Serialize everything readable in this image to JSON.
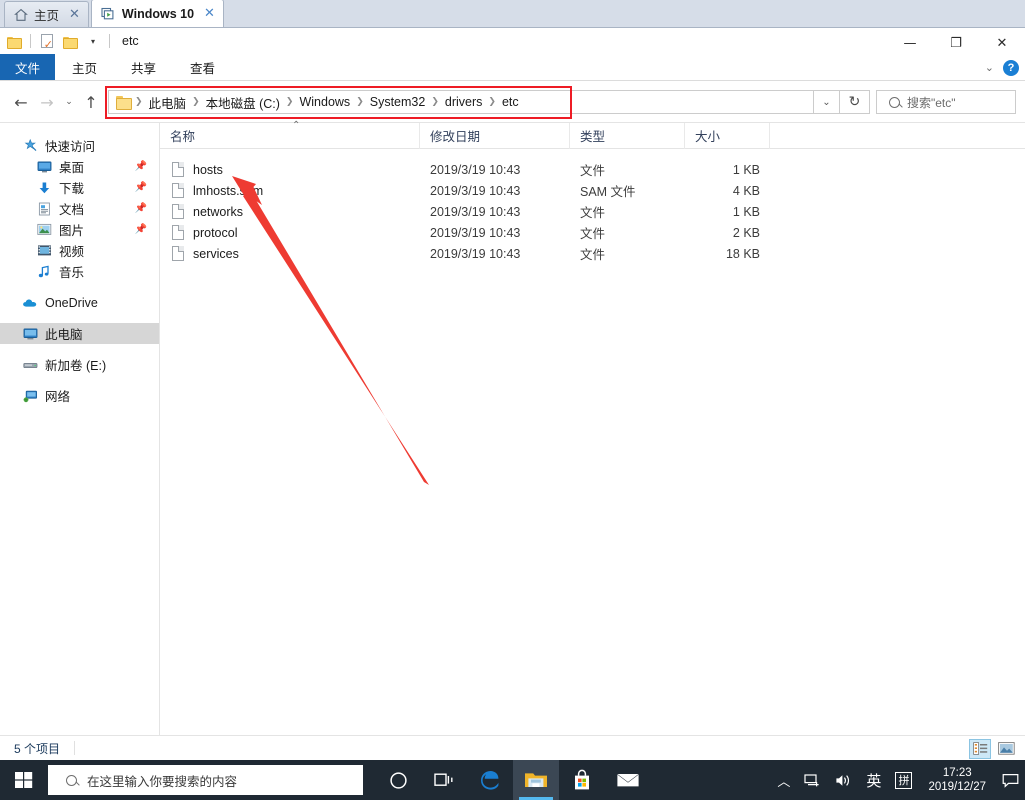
{
  "tabs": [
    {
      "label": "主页",
      "icon": "home-icon",
      "active": false,
      "close": "✕"
    },
    {
      "label": "Windows 10",
      "icon": "virtual-machine-icon",
      "active": true,
      "close": "✕"
    }
  ],
  "window": {
    "title": "etc",
    "minimize": "—",
    "maximize": "❐",
    "close": "✕"
  },
  "quick_access_toolbar": {
    "folder_icon": "folder-icon",
    "properties_icon": "properties-icon",
    "new_folder_icon": "new-folder-icon",
    "customize_caret": "▾"
  },
  "ribbon": {
    "tabs": [
      {
        "label": "文件",
        "active_style": "file"
      },
      {
        "label": "主页"
      },
      {
        "label": "共享"
      },
      {
        "label": "查看"
      }
    ],
    "collapse_caret": "⌄",
    "help": "?"
  },
  "navigation": {
    "back": "←",
    "forward": "→",
    "recent": "⌄",
    "up": "↑"
  },
  "address_bar": {
    "folder_icon": "folder-icon",
    "separator": "❯",
    "crumbs": [
      "此电脑",
      "本地磁盘 (C:)",
      "Windows",
      "System32",
      "drivers",
      "etc"
    ],
    "dropdown": "⌄",
    "refresh": "↻",
    "highlight_color": "#ee1c25"
  },
  "search": {
    "icon": "search-icon",
    "placeholder": "搜索\"etc\""
  },
  "sidebar": {
    "groups": [
      {
        "header": {
          "label": "快速访问",
          "icon": "star-pin-icon"
        },
        "items": [
          {
            "label": "桌面",
            "icon": "desktop-icon",
            "pinned": true
          },
          {
            "label": "下载",
            "icon": "download-icon",
            "pinned": true
          },
          {
            "label": "文档",
            "icon": "documents-icon",
            "pinned": true
          },
          {
            "label": "图片",
            "icon": "pictures-icon",
            "pinned": true
          },
          {
            "label": "视频",
            "icon": "videos-icon",
            "pinned": false
          },
          {
            "label": "音乐",
            "icon": "music-icon",
            "pinned": false
          }
        ]
      },
      {
        "items": [
          {
            "label": "OneDrive",
            "icon": "onedrive-cloud-icon",
            "pinned": false
          }
        ]
      },
      {
        "items": [
          {
            "label": "此电脑",
            "icon": "this-pc-icon",
            "pinned": false,
            "selected": true
          }
        ]
      },
      {
        "items": [
          {
            "label": "新加卷 (E:)",
            "icon": "drive-icon",
            "pinned": false
          }
        ]
      },
      {
        "items": [
          {
            "label": "网络",
            "icon": "network-icon",
            "pinned": false
          }
        ]
      }
    ],
    "pin_glyph": "📌"
  },
  "file_list": {
    "columns": [
      {
        "label": "名称",
        "key": "name",
        "sorted": "asc",
        "sort_glyph": "⌃"
      },
      {
        "label": "修改日期",
        "key": "date"
      },
      {
        "label": "类型",
        "key": "type"
      },
      {
        "label": "大小",
        "key": "size"
      }
    ],
    "rows": [
      {
        "name": "hosts",
        "date": "2019/3/19 10:43",
        "type": "文件",
        "size": "1 KB"
      },
      {
        "name": "lmhosts.sam",
        "date": "2019/3/19 10:43",
        "type": "SAM 文件",
        "size": "4 KB"
      },
      {
        "name": "networks",
        "date": "2019/3/19 10:43",
        "type": "文件",
        "size": "1 KB"
      },
      {
        "name": "protocol",
        "date": "2019/3/19 10:43",
        "type": "文件",
        "size": "2 KB"
      },
      {
        "name": "services",
        "date": "2019/3/19 10:43",
        "type": "文件",
        "size": "18 KB"
      }
    ]
  },
  "annotation": {
    "arrow_color": "#ee3b32",
    "points_to": "hosts"
  },
  "status_bar": {
    "item_count": "5 个项目",
    "views": [
      {
        "name": "details-view",
        "selected": true
      },
      {
        "name": "large-icons-view",
        "selected": false
      }
    ]
  },
  "taskbar": {
    "start": "start-button",
    "search_placeholder": "在这里输入你要搜索的内容",
    "search_icon": "search-icon",
    "items": [
      {
        "name": "cortana-icon",
        "active": false
      },
      {
        "name": "task-view-icon",
        "active": false
      },
      {
        "name": "edge-browser-icon",
        "active": false
      },
      {
        "name": "file-explorer-icon",
        "active": true
      },
      {
        "name": "microsoft-store-icon",
        "active": false
      },
      {
        "name": "mail-icon",
        "active": false
      }
    ],
    "tray": {
      "show_hidden": "︿",
      "network_icon": "network-tray-icon",
      "volume_icon": "volume-icon",
      "ime_mode": "英",
      "ime_pinyin": "拼",
      "time": "17:23",
      "date": "2019/12/27",
      "action_center": "action-center-icon"
    }
  }
}
